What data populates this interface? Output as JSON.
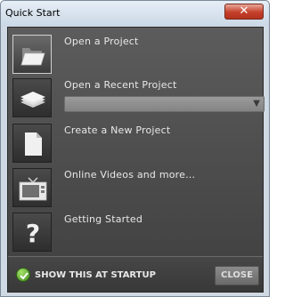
{
  "window": {
    "title": "Quick Start",
    "close_glyph": "✕"
  },
  "items": [
    {
      "label": "Open a Project",
      "icon": "folder-icon"
    },
    {
      "label": "Open a Recent Project",
      "icon": "stacked-documents-icon",
      "select_value": ""
    },
    {
      "label": "Create a New Project",
      "icon": "new-document-icon"
    },
    {
      "label": "Online Videos and more...",
      "icon": "television-icon"
    },
    {
      "label": "Getting Started",
      "icon": "question-mark-icon",
      "glyph": "?"
    }
  ],
  "footer": {
    "startup_label": "SHOW THIS AT STARTUP",
    "startup_checked": true,
    "close_label": "CLOSE"
  },
  "colors": {
    "panel": "#4a4a4a",
    "text": "#e8e8e8",
    "check_green": "#5cb82a",
    "title_close_red": "#c4402a"
  }
}
